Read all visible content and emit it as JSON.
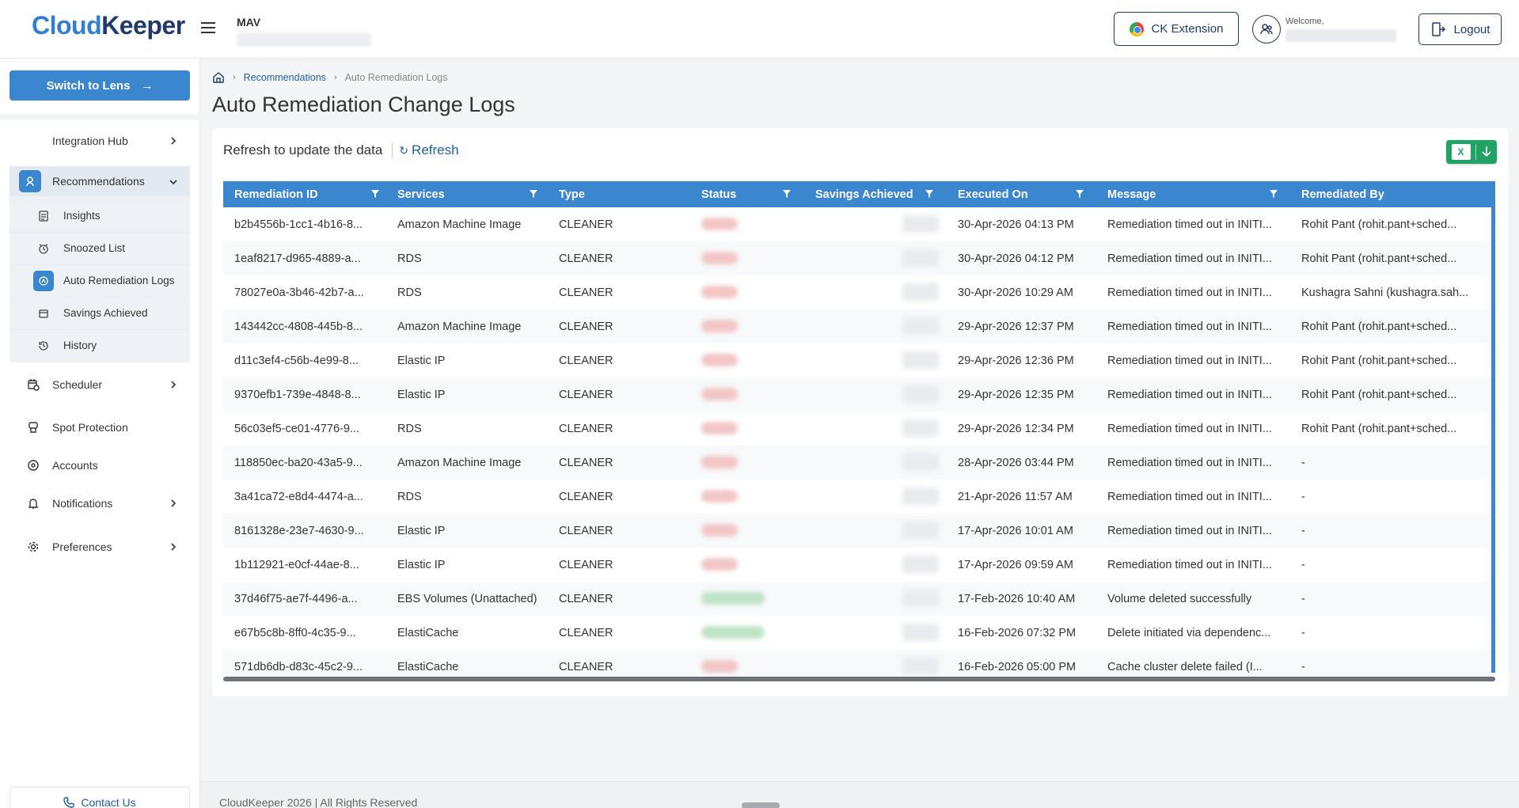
{
  "header": {
    "logo_part1": "Cloud",
    "logo_part2": "Keeper",
    "org_name": "MAV",
    "ck_extension_label": "CK Extension",
    "welcome_label": "Welcome,",
    "logout_label": "Logout"
  },
  "sidebar": {
    "switch_label": "Switch to Lens",
    "integration_hub": "Integration Hub",
    "recommendations": "Recommendations",
    "sub_items": [
      {
        "label": "Insights",
        "icon": "document-icon"
      },
      {
        "label": "Snoozed List",
        "icon": "snooze-icon"
      },
      {
        "label": "Auto Remediation Logs",
        "icon": "auto-remediation-icon"
      },
      {
        "label": "Savings Achieved",
        "icon": "savings-icon"
      },
      {
        "label": "History",
        "icon": "history-icon"
      }
    ],
    "scheduler": "Scheduler",
    "spot_protection": "Spot Protection",
    "accounts": "Accounts",
    "notifications": "Notifications",
    "preferences": "Preferences",
    "contact_us": "Contact Us"
  },
  "breadcrumb": {
    "recommendations": "Recommendations",
    "current": "Auto Remediation Logs"
  },
  "page": {
    "title": "Auto Remediation Change Logs",
    "refresh_hint": "Refresh to update the data",
    "refresh_label": "Refresh"
  },
  "table": {
    "columns": [
      "Remediation ID",
      "Services",
      "Type",
      "Status",
      "Savings Achieved",
      "Executed On",
      "Message",
      "Remediated By"
    ],
    "rows": [
      {
        "id": "b2b4556b-1cc1-4b16-8...",
        "service": "Amazon Machine Image",
        "type": "CLEANER",
        "status": "red",
        "executed": "30-Apr-2026 04:13 PM",
        "message": "Remediation timed out in INITI...",
        "by": "Rohit Pant (rohit.pant+sched..."
      },
      {
        "id": "1eaf8217-d965-4889-a...",
        "service": "RDS",
        "type": "CLEANER",
        "status": "red",
        "executed": "30-Apr-2026 04:12 PM",
        "message": "Remediation timed out in INITI...",
        "by": "Rohit Pant (rohit.pant+sched..."
      },
      {
        "id": "78027e0a-3b46-42b7-a...",
        "service": "RDS",
        "type": "CLEANER",
        "status": "red",
        "executed": "30-Apr-2026 10:29 AM",
        "message": "Remediation timed out in INITI...",
        "by": "Kushagra Sahni (kushagra.sah..."
      },
      {
        "id": "143442cc-4808-445b-8...",
        "service": "Amazon Machine Image",
        "type": "CLEANER",
        "status": "red",
        "executed": "29-Apr-2026 12:37 PM",
        "message": "Remediation timed out in INITI...",
        "by": "Rohit Pant (rohit.pant+sched..."
      },
      {
        "id": "d11c3ef4-c56b-4e99-8...",
        "service": "Elastic IP",
        "type": "CLEANER",
        "status": "red",
        "executed": "29-Apr-2026 12:36 PM",
        "message": "Remediation timed out in INITI...",
        "by": "Rohit Pant (rohit.pant+sched..."
      },
      {
        "id": "9370efb1-739e-4848-8...",
        "service": "Elastic IP",
        "type": "CLEANER",
        "status": "red",
        "executed": "29-Apr-2026 12:35 PM",
        "message": "Remediation timed out in INITI...",
        "by": "Rohit Pant (rohit.pant+sched..."
      },
      {
        "id": "56c03ef5-ce01-4776-9...",
        "service": "RDS",
        "type": "CLEANER",
        "status": "red",
        "executed": "29-Apr-2026 12:34 PM",
        "message": "Remediation timed out in INITI...",
        "by": "Rohit Pant (rohit.pant+sched..."
      },
      {
        "id": "118850ec-ba20-43a5-9...",
        "service": "Amazon Machine Image",
        "type": "CLEANER",
        "status": "red",
        "executed": "28-Apr-2026 03:44 PM",
        "message": "Remediation timed out in INITI...",
        "by": "-"
      },
      {
        "id": "3a41ca72-e8d4-4474-a...",
        "service": "RDS",
        "type": "CLEANER",
        "status": "red",
        "executed": "21-Apr-2026 11:57 AM",
        "message": "Remediation timed out in INITI...",
        "by": "-"
      },
      {
        "id": "8161328e-23e7-4630-9...",
        "service": "Elastic IP",
        "type": "CLEANER",
        "status": "red",
        "executed": "17-Apr-2026 10:01 AM",
        "message": "Remediation timed out in INITI...",
        "by": "-"
      },
      {
        "id": "1b112921-e0cf-44ae-8...",
        "service": "Elastic IP",
        "type": "CLEANER",
        "status": "red",
        "executed": "17-Apr-2026 09:59 AM",
        "message": "Remediation timed out in INITI...",
        "by": "-"
      },
      {
        "id": "37d46f75-ae7f-4496-a...",
        "service": "EBS Volumes (Unattached)",
        "type": "CLEANER",
        "status": "green",
        "executed": "17-Feb-2026 10:40 AM",
        "message": "Volume deleted successfully",
        "by": "-"
      },
      {
        "id": "e67b5c8b-8ff0-4c35-9...",
        "service": "ElastiCache",
        "type": "CLEANER",
        "status": "green",
        "executed": "16-Feb-2026 07:32 PM",
        "message": "Delete initiated via dependenc...",
        "by": "-"
      },
      {
        "id": "571db6db-d83c-45c2-9...",
        "service": "ElastiCache",
        "type": "CLEANER",
        "status": "red",
        "executed": "16-Feb-2026 05:00 PM",
        "message": "Cache cluster delete failed (I...",
        "by": "-"
      }
    ]
  },
  "footer": {
    "text": "CloudKeeper 2026 | All Rights Reserved"
  },
  "colors": {
    "accent": "#3a86cf",
    "brand_dark": "#1f3a6b",
    "excel_green": "#21a366"
  }
}
